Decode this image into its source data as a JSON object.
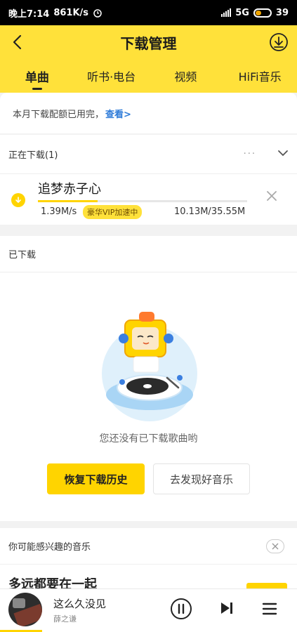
{
  "status_bar": {
    "time": "晚上7:14",
    "speed": "861K/s",
    "network": "5G",
    "battery": "39"
  },
  "header": {
    "title": "下载管理",
    "tabs": [
      {
        "label": "单曲",
        "active": true
      },
      {
        "label": "听书·电台",
        "active": false
      },
      {
        "label": "视频",
        "active": false
      },
      {
        "label": "HiFi音乐",
        "active": false
      }
    ]
  },
  "quota": {
    "text": "本月下载配额已用完，",
    "link": "查看>"
  },
  "downloading": {
    "header": "正在下载(1)",
    "more": "···",
    "item": {
      "title": "追梦赤子心",
      "speed": "1.39M/s",
      "badge": "豪华VIP加速中",
      "size": "10.13M/35.55M",
      "progress": 0.285
    }
  },
  "downloaded": {
    "header": "已下载",
    "empty_text": "您还没有已下载歌曲哟",
    "restore_button": "恢复下载历史",
    "discover_button": "去发现好音乐"
  },
  "recommend": {
    "header": "你可能感兴趣的音乐",
    "song": "多远都要在一起"
  },
  "player": {
    "title": "这么久没见",
    "artist": "薛之谦"
  },
  "colors": {
    "accent": "#ffd400",
    "header_bg": "#ffe13a",
    "link": "#2e7bd8"
  }
}
